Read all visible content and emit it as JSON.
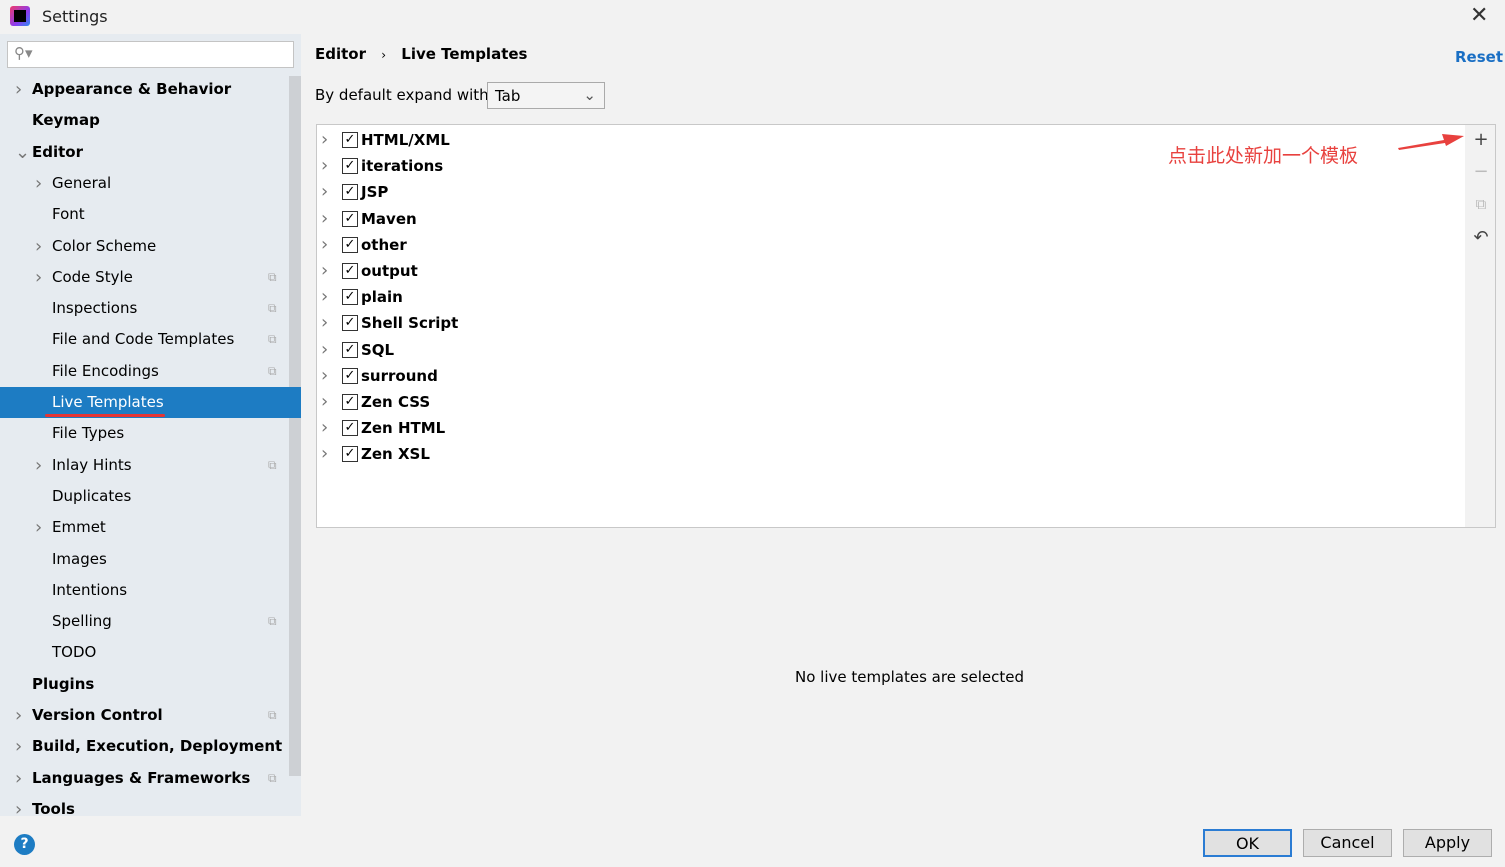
{
  "window": {
    "title": "Settings",
    "close_icon": "close-icon"
  },
  "sidebar": {
    "search_placeholder": "",
    "items": [
      {
        "label": "Appearance & Behavior",
        "level": 0,
        "bold": true,
        "expand": "collapsed"
      },
      {
        "label": "Keymap",
        "level": 0,
        "bold": true
      },
      {
        "label": "Editor",
        "level": 0,
        "bold": true,
        "expand": "expanded"
      },
      {
        "label": "General",
        "level": 1,
        "expand": "collapsed"
      },
      {
        "label": "Font",
        "level": 1
      },
      {
        "label": "Color Scheme",
        "level": 1,
        "expand": "collapsed"
      },
      {
        "label": "Code Style",
        "level": 1,
        "expand": "collapsed",
        "copy": true
      },
      {
        "label": "Inspections",
        "level": 1,
        "copy": true
      },
      {
        "label": "File and Code Templates",
        "level": 1,
        "copy": true
      },
      {
        "label": "File Encodings",
        "level": 1,
        "copy": true
      },
      {
        "label": "Live Templates",
        "level": 1,
        "selected": true
      },
      {
        "label": "File Types",
        "level": 1
      },
      {
        "label": "Inlay Hints",
        "level": 1,
        "expand": "collapsed",
        "copy": true
      },
      {
        "label": "Duplicates",
        "level": 1
      },
      {
        "label": "Emmet",
        "level": 1,
        "expand": "collapsed"
      },
      {
        "label": "Images",
        "level": 1
      },
      {
        "label": "Intentions",
        "level": 1
      },
      {
        "label": "Spelling",
        "level": 1,
        "copy": true
      },
      {
        "label": "TODO",
        "level": 1
      },
      {
        "label": "Plugins",
        "level": 0,
        "bold": true
      },
      {
        "label": "Version Control",
        "level": 0,
        "bold": true,
        "expand": "collapsed",
        "copy": true
      },
      {
        "label": "Build, Execution, Deployment",
        "level": 0,
        "bold": true,
        "expand": "collapsed"
      },
      {
        "label": "Languages & Frameworks",
        "level": 0,
        "bold": true,
        "expand": "collapsed",
        "copy": true
      },
      {
        "label": "Tools",
        "level": 0,
        "bold": true,
        "expand": "collapsed"
      }
    ]
  },
  "main": {
    "breadcrumb": [
      "Editor",
      "Live Templates"
    ],
    "reset": "Reset",
    "expand_label": "By default expand with",
    "expand_value": "Tab",
    "templates": [
      "HTML/XML",
      "iterations",
      "JSP",
      "Maven",
      "other",
      "output",
      "plain",
      "Shell Script",
      "SQL",
      "surround",
      "Zen CSS",
      "Zen HTML",
      "Zen XSL"
    ],
    "annotation": "点击此处新加一个模板",
    "empty_text": "No live templates are selected",
    "annotation_color": "#e8413e"
  },
  "footer": {
    "ok": "OK",
    "cancel": "Cancel",
    "apply": "Apply",
    "help": "?"
  }
}
